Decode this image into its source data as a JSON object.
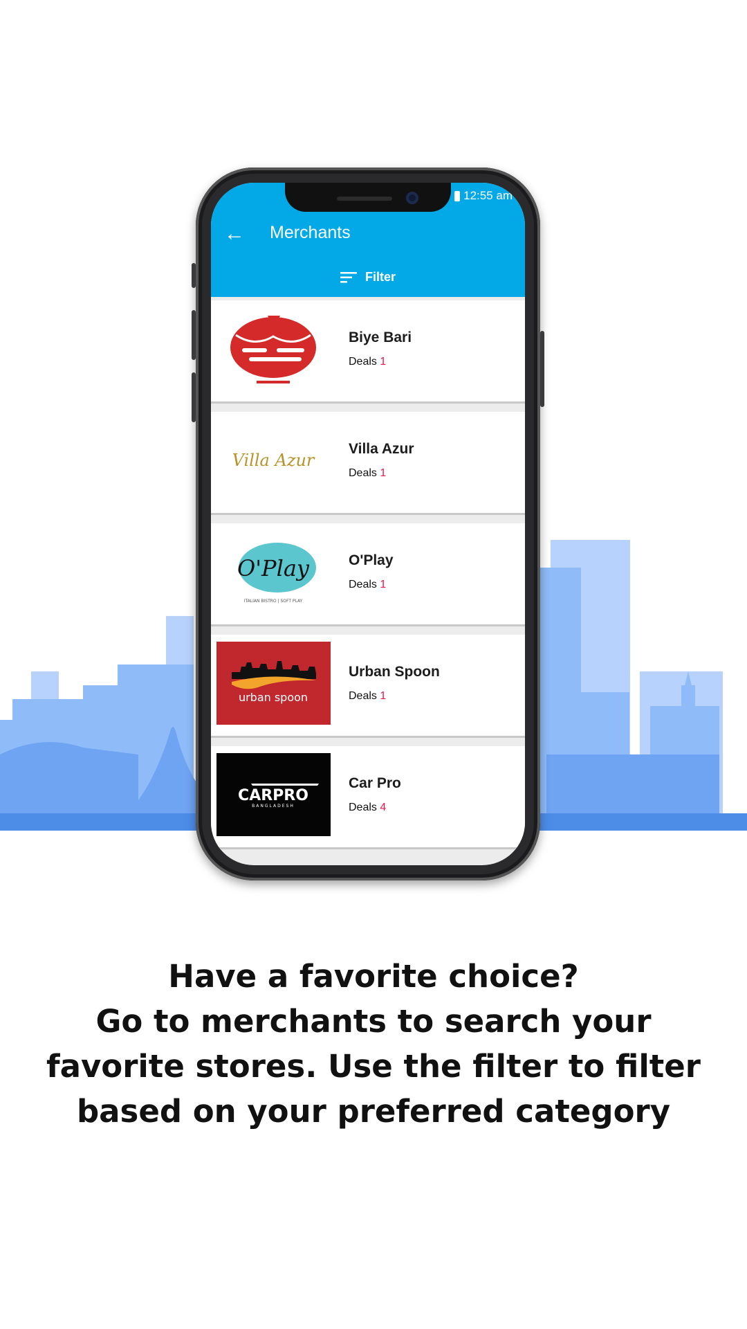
{
  "app": {
    "status_time": "12:55 am",
    "title": "Merchants",
    "filter_label": "Filter",
    "deals_label": "Deals"
  },
  "merchants": [
    {
      "name": "Biye Bari",
      "deals": "1",
      "logo": "biye-bari-logo"
    },
    {
      "name": "Villa Azur",
      "deals": "1",
      "logo": "villa-azur-logo",
      "logo_text": "Villa Azur"
    },
    {
      "name": "O'Play",
      "deals": "1",
      "logo": "oplay-logo",
      "logo_text": "O'Play",
      "logo_subtext": "ITALIAN BISTRO | SOFT PLAY"
    },
    {
      "name": "Urban Spoon",
      "deals": "1",
      "logo": "urban-spoon-logo",
      "logo_text": "urban spoon"
    },
    {
      "name": "Car Pro",
      "deals": "4",
      "logo": "carpro-logo",
      "logo_text": "CARPRO",
      "logo_subtext": "BANGLADESH"
    }
  ],
  "caption": {
    "line1": "Have a favorite choice?",
    "line2": "Go to merchants to search your",
    "line3": "favorite stores. Use the filter to filter",
    "line4": "based on your preferred category"
  },
  "colors": {
    "appbar": "#03a9e6",
    "deal_count": "#e8174a",
    "skyline_light": "#a9c9fb",
    "skyline_mid": "#7fb0f7",
    "skyline_dark": "#4f8fea"
  }
}
